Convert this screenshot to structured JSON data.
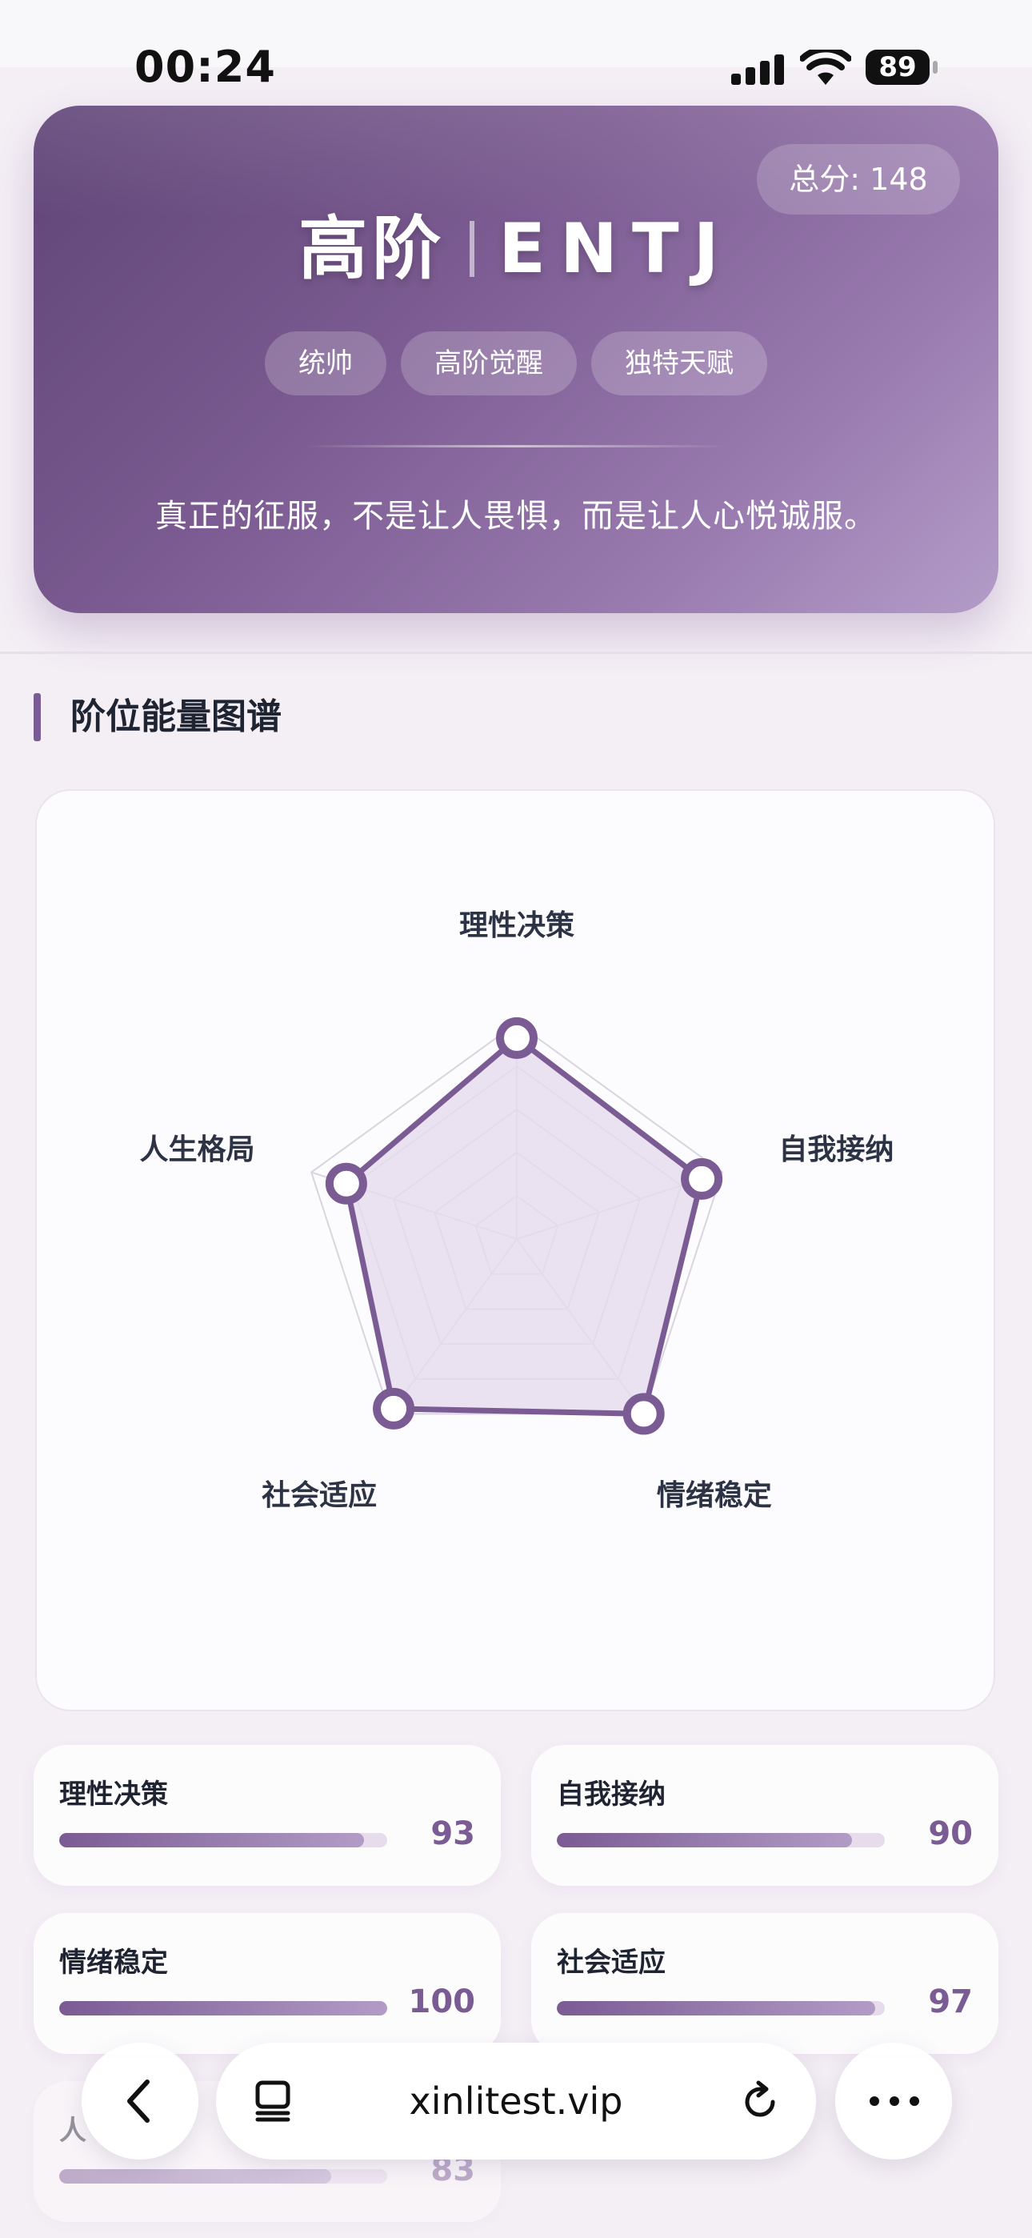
{
  "status_bar": {
    "time": "00:24",
    "battery": "89"
  },
  "hero": {
    "score": "总分: 148",
    "level": "高阶",
    "type": "ENTJ",
    "tags": [
      "统帅",
      "高阶觉醒",
      "独特天赋"
    ],
    "quote": "真正的征服，不是让人畏惧，而是让人心悦诚服。"
  },
  "section": {
    "title": "阶位能量图谱"
  },
  "chart_data": {
    "type": "radar",
    "axes": [
      "理性决策",
      "自我接纳",
      "情绪稳定",
      "社会适应",
      "人生格局"
    ],
    "values": [
      93,
      90,
      100,
      97,
      83
    ],
    "range": [
      0,
      100
    ],
    "levels": 5,
    "colors": {
      "line": "#7a5b93",
      "fill": "#e5dcec",
      "grid": "#d9d4de"
    }
  },
  "score_cards": [
    {
      "label": "理性决策",
      "value": "93",
      "fraction": 0.93
    },
    {
      "label": "自我接纳",
      "value": "90",
      "fraction": 0.9
    },
    {
      "label": "情绪稳定",
      "value": "100",
      "fraction": 1.0
    },
    {
      "label": "社会适应",
      "value": "97",
      "fraction": 0.97
    },
    {
      "label": "人",
      "value": "83",
      "fraction": 0.83
    }
  ],
  "browser": {
    "url": "xinlitest.vip"
  }
}
